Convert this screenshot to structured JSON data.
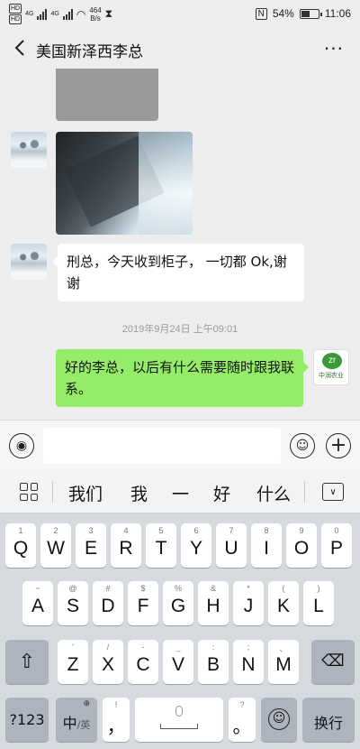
{
  "status": {
    "hd1": "HD",
    "hd2": "HD",
    "net1": "4G",
    "net2": "4G",
    "speed_value": "464",
    "speed_unit": "B/s",
    "nfc": "N",
    "battery": "54%",
    "battery_level": 0.54,
    "time": "11:06"
  },
  "title": "美国新泽西李总",
  "more_icon": "more-icon",
  "messages": {
    "m1": "刑总，今天收到柜子， 一切都 Ok,谢谢",
    "timestamp": "2019年9月24日 上午09:01",
    "m2": "好的李总，以后有什么需要随时跟我联系。"
  },
  "avatar_logo": {
    "icon": "zr",
    "text": "中润农业"
  },
  "inputbar": {
    "voice_icon": "voice-icon",
    "emoji_icon": "emoji-icon",
    "plus_icon": "+"
  },
  "candidates": [
    "我们",
    "我",
    "一",
    "好",
    "什么"
  ],
  "keys_row1": [
    {
      "sub": "1",
      "main": "Q"
    },
    {
      "sub": "2",
      "main": "W"
    },
    {
      "sub": "3",
      "main": "E"
    },
    {
      "sub": "4",
      "main": "R"
    },
    {
      "sub": "5",
      "main": "T"
    },
    {
      "sub": "6",
      "main": "Y"
    },
    {
      "sub": "7",
      "main": "U"
    },
    {
      "sub": "8",
      "main": "I"
    },
    {
      "sub": "9",
      "main": "O"
    },
    {
      "sub": "0",
      "main": "P"
    }
  ],
  "keys_row2": [
    {
      "sub": "~",
      "main": "A"
    },
    {
      "sub": "@",
      "main": "S"
    },
    {
      "sub": "#",
      "main": "D"
    },
    {
      "sub": "$",
      "main": "F"
    },
    {
      "sub": "%",
      "main": "G"
    },
    {
      "sub": "&",
      "main": "H"
    },
    {
      "sub": "*",
      "main": "J"
    },
    {
      "sub": "(",
      "main": "K"
    },
    {
      "sub": ")",
      "main": "L"
    }
  ],
  "keys_row3": [
    {
      "sub": "'",
      "main": "Z"
    },
    {
      "sub": "/",
      "main": "X"
    },
    {
      "sub": "-",
      "main": "C"
    },
    {
      "sub": "_",
      "main": "V"
    },
    {
      "sub": ":",
      "main": "B"
    },
    {
      "sub": ";",
      "main": "N"
    },
    {
      "sub": "、",
      "main": "M"
    }
  ],
  "bottom": {
    "num": "?123",
    "lang_main": "中",
    "lang_sub": "/英",
    "comma_sub": "!",
    "comma": "，",
    "period_sub": "?",
    "period": "。",
    "enter": "换行"
  }
}
